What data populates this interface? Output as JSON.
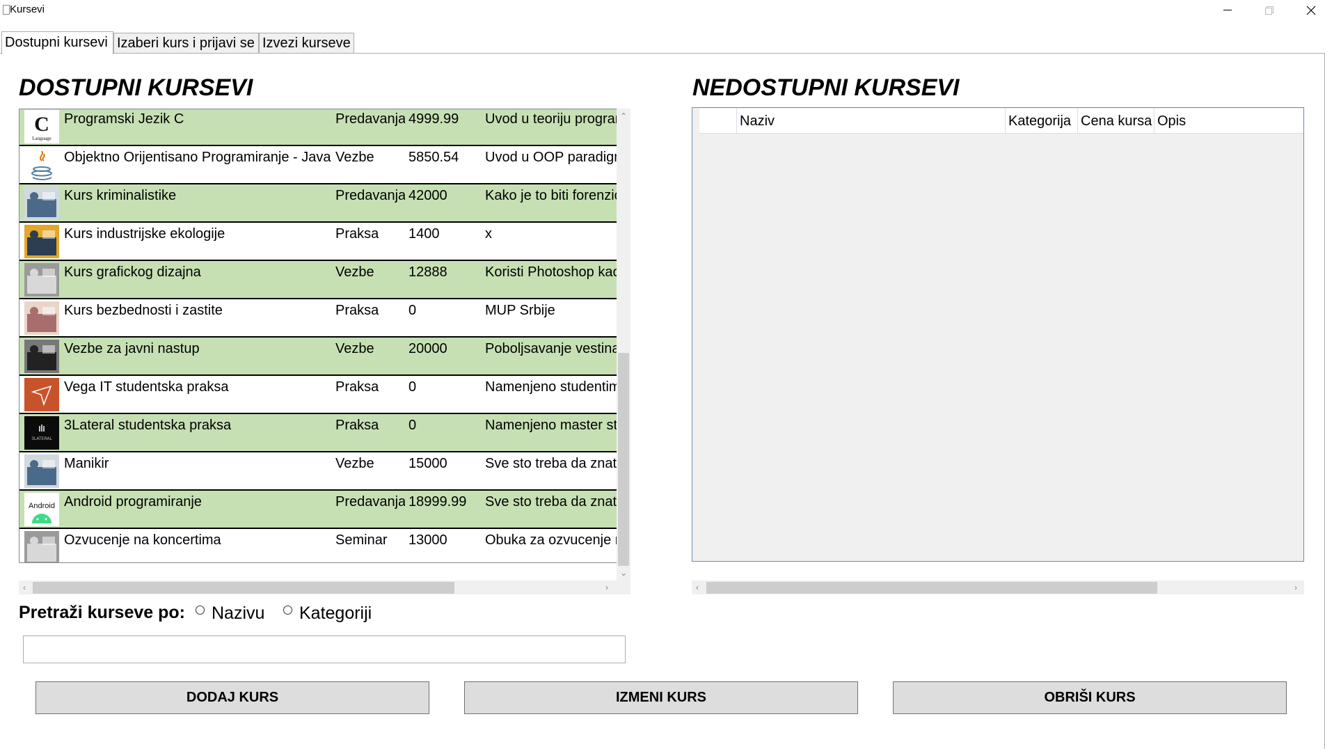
{
  "window": {
    "title": "Kursevi"
  },
  "tabs": [
    "Dostupni kursevi",
    "Izaberi kurs i prijavi se",
    "Izvezi kurseve"
  ],
  "available": {
    "heading": "DOSTUPNI KURSEVI",
    "rows": [
      {
        "name": "Programski Jezik C",
        "category": "Predavanja",
        "price": "4999.99",
        "description": "Uvod u teoriju programiranja",
        "thumb": "c-language",
        "thumb_text": "Language"
      },
      {
        "name": "Objektno Orijentisano Programiranje - Java",
        "category": "Vezbe",
        "price": "5850.54",
        "description": "Uvod u OOP paradigmu",
        "thumb": "java"
      },
      {
        "name": "Kurs kriminalistike",
        "category": "Predavanja",
        "price": "42000",
        "description": "Kako je to biti forenzicar",
        "thumb": "photo"
      },
      {
        "name": "Kurs industrijske ekologije",
        "category": "Praksa",
        "price": "1400",
        "description": "x",
        "thumb": "photo"
      },
      {
        "name": "Kurs grafickog dizajna",
        "category": "Vezbe",
        "price": "12888",
        "description": "Koristi Photoshop kao profesionalac",
        "thumb": "photo"
      },
      {
        "name": "Kurs bezbednosti i zastite",
        "category": "Praksa",
        "price": "0",
        "description": "MUP Srbije",
        "thumb": "photo"
      },
      {
        "name": "Vezbe za javni nastup",
        "category": "Vezbe",
        "price": "20000",
        "description": "Poboljsavanje vestina",
        "thumb": "photo"
      },
      {
        "name": "Vega IT studentska praksa",
        "category": "Praksa",
        "price": "0",
        "description": "Namenjeno studentima",
        "thumb": "vega"
      },
      {
        "name": "3Lateral studentska praksa",
        "category": "Praksa",
        "price": "0",
        "description": "Namenjeno master studentima",
        "thumb": "3lateral",
        "thumb_text": "3LATERAL"
      },
      {
        "name": "Manikir",
        "category": "Vezbe",
        "price": "15000",
        "description": "Sve sto treba da znate",
        "thumb": "photo"
      },
      {
        "name": "Android programiranje",
        "category": "Predavanja",
        "price": "18999.99",
        "description": "Sve sto treba da znate",
        "thumb": "android",
        "thumb_text": "Android"
      },
      {
        "name": "Ozvucenje na koncertima",
        "category": "Seminar",
        "price": "13000",
        "description": "Obuka za ozvucenje na koncertima",
        "thumb": "photo"
      }
    ]
  },
  "unavailable": {
    "heading": "NEDOSTUPNI KURSEVI",
    "columns": [
      "",
      "Naziv",
      "Kategorija",
      "Cena kursa",
      "Opis"
    ]
  },
  "search": {
    "label": "Pretraži kurseve po:",
    "options": [
      "Nazivu",
      "Kategoriji"
    ],
    "value": ""
  },
  "buttons": {
    "add": "DODAJ KURS",
    "edit": "IZMENI KURS",
    "delete": "OBRIŠI KURS"
  },
  "colors": {
    "row_green": "#c6e0b4",
    "tab_bg": "#f0f0f0"
  },
  "icons": [
    "minimize-icon",
    "maximize-icon",
    "close-icon",
    "scroll-up-icon",
    "scroll-down-icon",
    "scroll-left-icon",
    "scroll-right-icon"
  ]
}
